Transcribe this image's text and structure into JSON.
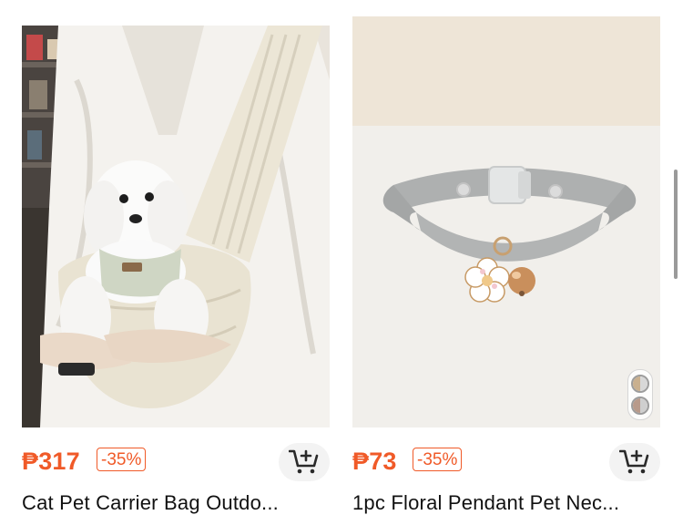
{
  "products": [
    {
      "price": "₱317",
      "discount": "-35%",
      "title": "Cat Pet Carrier Bag Outdo...",
      "image_desc": "dog-in-sling-carrier-photo"
    },
    {
      "price": "₱73",
      "discount": "-35%",
      "title": "1pc Floral Pendant Pet Nec...",
      "image_desc": "grey-collar-with-flower-charm-photo",
      "color_swatches": [
        [
          "#c9b08f",
          "#d8d8d8"
        ],
        [
          "#b89a8a",
          "#cfcfcf"
        ]
      ]
    }
  ],
  "colors": {
    "price": "#f05a28",
    "cart_button_bg": "#f3f3f3"
  },
  "icons": {
    "cart": "add-to-cart-icon"
  }
}
